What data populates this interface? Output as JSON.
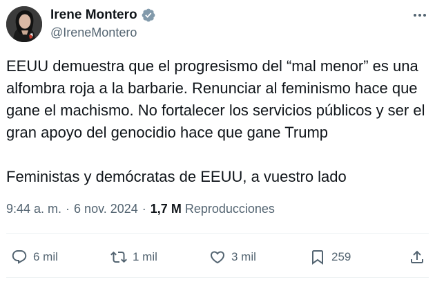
{
  "author": {
    "name": "Irene Montero",
    "handle": "@IreneMontero"
  },
  "tweet": {
    "paragraph1": "EEUU demuestra que el progresismo del “mal menor” es una alfombra roja a la barbarie. Renunciar al feminismo hace que gane el machismo. No fortalecer los servicios públicos y ser el gran apoyo del genocidio hace que gane Trump",
    "paragraph2": "Feministas y demócratas de EEUU, a vuestro lado"
  },
  "meta": {
    "time": "9:44 a. m.",
    "separator": "·",
    "date": "6 nov. 2024",
    "views_count": "1,7 M",
    "views_label": "Reproducciones"
  },
  "actions": {
    "replies": "6 mil",
    "reposts": "1 mil",
    "likes": "3 mil",
    "bookmarks": "259"
  },
  "icons": {
    "verified": "verified-badge-icon",
    "more": "more-dots-icon",
    "reply": "reply-icon",
    "repost": "repost-icon",
    "like": "heart-icon",
    "bookmark": "bookmark-icon",
    "share": "share-icon"
  },
  "colors": {
    "text": "#0f1419",
    "secondary": "#536471",
    "verified": "#829aab",
    "divider": "#eff3f4"
  }
}
